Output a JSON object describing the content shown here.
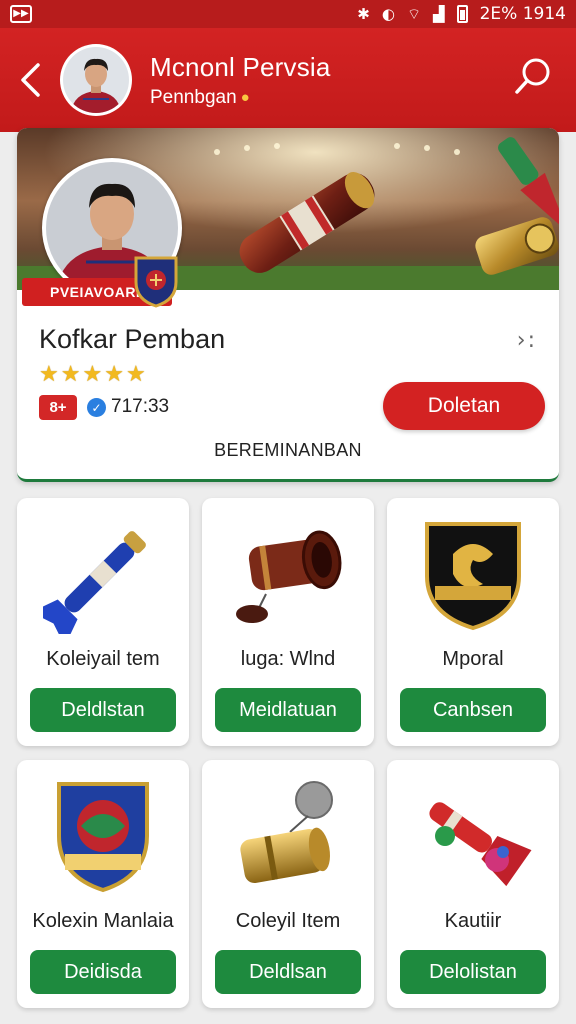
{
  "status_bar": {
    "text": "2E% 1914"
  },
  "header": {
    "title": "Mcnonl Pervsia",
    "subtitle": "Pennbgan"
  },
  "profile": {
    "ribbon": "PVEIAVOARI",
    "name": "Kofkar Pemban",
    "rating": 5,
    "badge": "8+",
    "score": "717:33",
    "primary_button": "Doletan",
    "caption": "BEREMINANBAN"
  },
  "items": [
    {
      "label": "Koleiyail tem",
      "button": "Deldlstan"
    },
    {
      "label": "luga: Wlnd",
      "button": "Meidlatuan"
    },
    {
      "label": "Mporal",
      "button": "Canbsen"
    },
    {
      "label": "Kolexin Manlaia",
      "button": "Deidisda"
    },
    {
      "label": "Coleyil Item",
      "button": "Deldlsan"
    },
    {
      "label": "Kautiir",
      "button": "Delolistan"
    }
  ],
  "colors": {
    "header_red": "#c21a1a",
    "action_green": "#1e8a3e",
    "primary_red": "#d32222"
  }
}
